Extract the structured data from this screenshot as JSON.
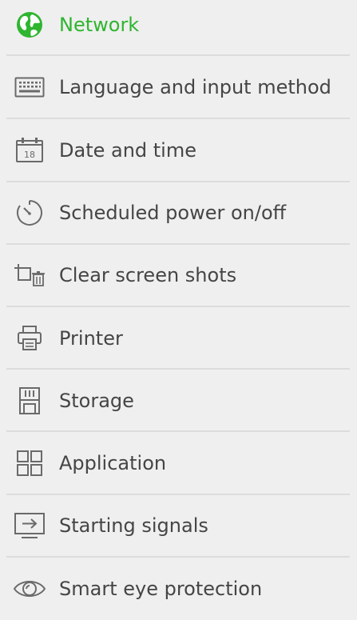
{
  "colors": {
    "background": "#efefef",
    "text": "#454545",
    "accent": "#2fb52f",
    "icon": "#6a6a6a",
    "divider": "#dcdcdc"
  },
  "settings_menu": {
    "items": [
      {
        "label": "Network",
        "icon": "globe-icon",
        "selected": true
      },
      {
        "label": "Language and input method",
        "icon": "keyboard-icon",
        "selected": false
      },
      {
        "label": "Date and time",
        "icon": "calendar-icon",
        "selected": false
      },
      {
        "label": "Scheduled power on/off",
        "icon": "timer-icon",
        "selected": false
      },
      {
        "label": "Clear screen shots",
        "icon": "crop-delete-icon",
        "selected": false
      },
      {
        "label": "Printer",
        "icon": "printer-icon",
        "selected": false
      },
      {
        "label": "Storage",
        "icon": "storage-card-icon",
        "selected": false
      },
      {
        "label": "Application",
        "icon": "app-grid-icon",
        "selected": false
      },
      {
        "label": "Starting signals",
        "icon": "input-source-icon",
        "selected": false
      },
      {
        "label": "Smart eye protection",
        "icon": "eye-icon",
        "selected": false
      }
    ],
    "date_icon_day": "18"
  }
}
